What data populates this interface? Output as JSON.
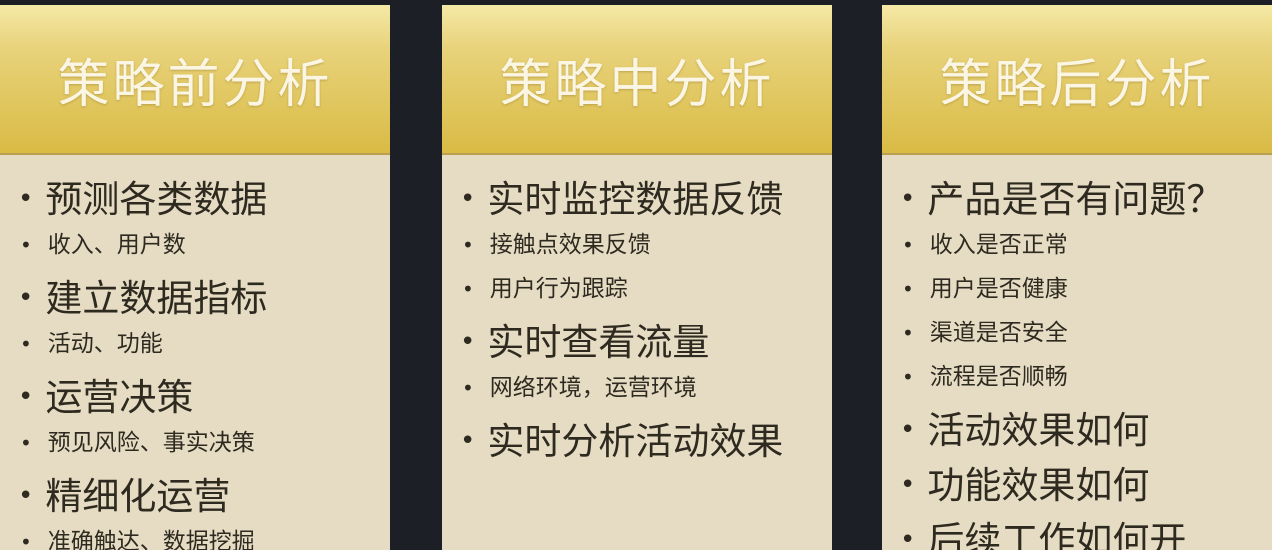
{
  "columns": [
    {
      "title": "策略前分析",
      "items": [
        {
          "text": "预测各类数据",
          "size": "big"
        },
        {
          "text": "收入、用户数",
          "size": "small"
        },
        {
          "text": "建立数据指标",
          "size": "big"
        },
        {
          "text": "活动、功能",
          "size": "small"
        },
        {
          "text": "运营决策",
          "size": "big"
        },
        {
          "text": "预见风险、事实决策",
          "size": "small"
        },
        {
          "text": "精细化运营",
          "size": "big"
        },
        {
          "text": "准确触达、数据挖掘",
          "size": "small"
        }
      ]
    },
    {
      "title": "策略中分析",
      "items": [
        {
          "text": "实时监控数据反馈",
          "size": "big"
        },
        {
          "text": "接触点效果反馈",
          "size": "small"
        },
        {
          "text": "用户行为跟踪",
          "size": "small"
        },
        {
          "text": "实时查看流量",
          "size": "big"
        },
        {
          "text": "网络环境，运营环境",
          "size": "small"
        },
        {
          "text": "实时分析活动效果",
          "size": "big"
        }
      ]
    },
    {
      "title": "策略后分析",
      "items": [
        {
          "text": "产品是否有问题？",
          "size": "big"
        },
        {
          "text": "收入是否正常",
          "size": "small"
        },
        {
          "text": "用户是否健康",
          "size": "small"
        },
        {
          "text": "渠道是否安全",
          "size": "small"
        },
        {
          "text": "流程是否顺畅",
          "size": "small"
        },
        {
          "text": "活动效果如何",
          "size": "big"
        },
        {
          "text": "功能效果如何",
          "size": "big"
        },
        {
          "text": "后续工作如何开",
          "size": "big"
        }
      ]
    }
  ],
  "colors": {
    "background": "#1d1f26",
    "card_body": "#e6dcc4",
    "header_gold": "#d9bb45",
    "title_text": "#fbf6e4",
    "body_text": "#2e2a20"
  }
}
